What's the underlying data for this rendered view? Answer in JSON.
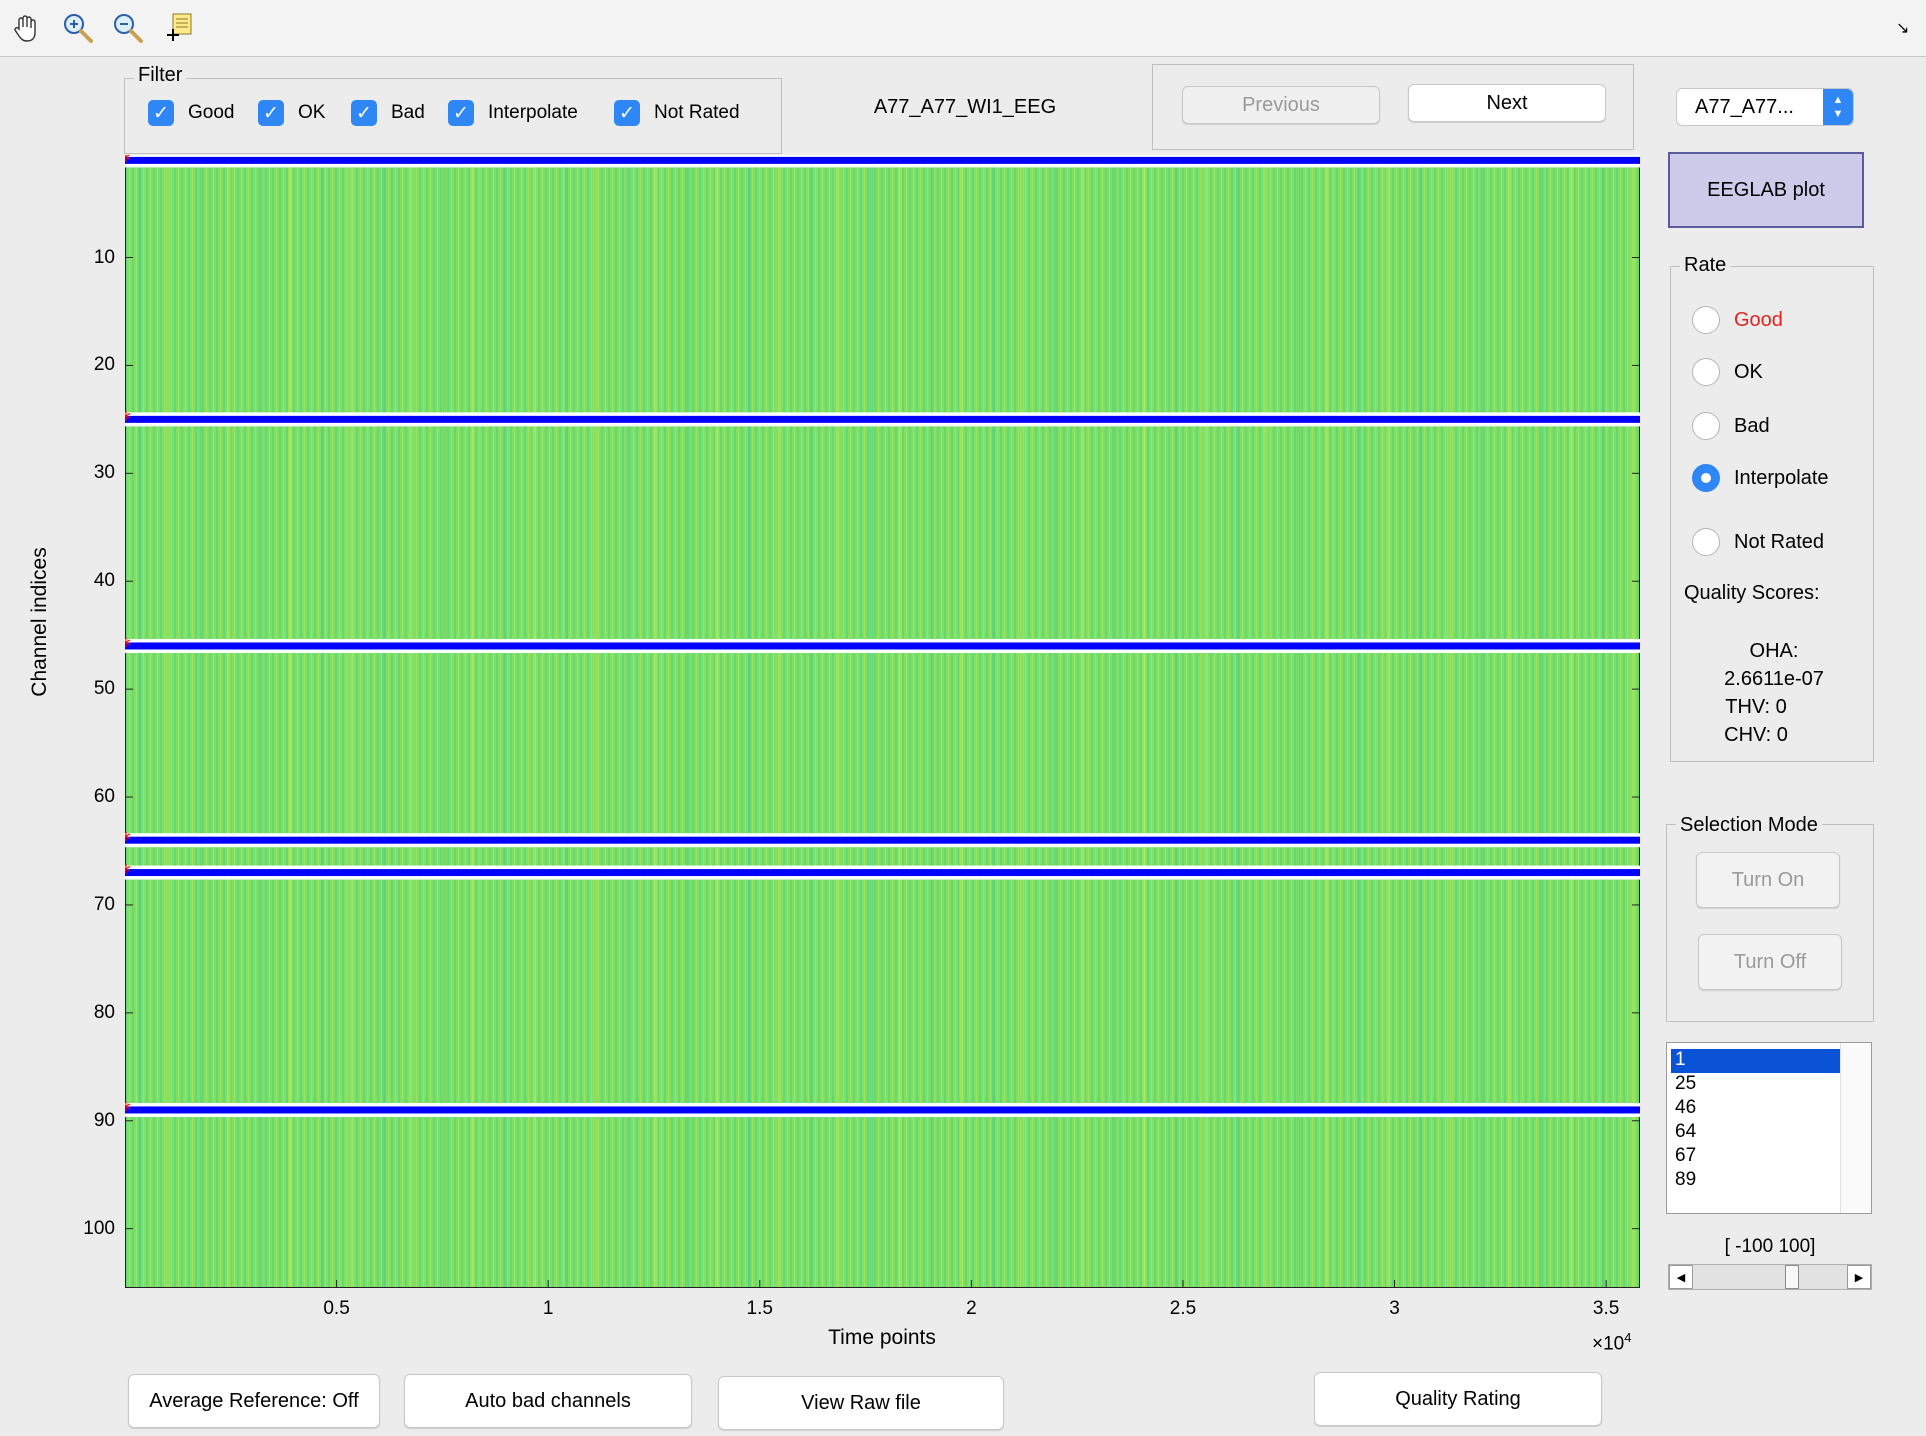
{
  "toolbar": {
    "icons": [
      "hand-pan-icon",
      "zoom-in-icon",
      "zoom-out-icon",
      "data-cursor-icon"
    ],
    "right_icon": "undock-icon"
  },
  "filter": {
    "title": "Filter",
    "items": [
      {
        "label": "Good",
        "checked": true
      },
      {
        "label": "OK",
        "checked": true
      },
      {
        "label": "Bad",
        "checked": true
      },
      {
        "label": "Interpolate",
        "checked": true
      },
      {
        "label": "Not Rated",
        "checked": true
      }
    ]
  },
  "file_name": "A77_A77_WI1_EEG",
  "nav": {
    "previous": "Previous",
    "next": "Next"
  },
  "subject_select": {
    "value": "A77_A77..."
  },
  "eeglab_button": "EEGLAB plot",
  "rate": {
    "title": "Rate",
    "options": [
      {
        "label": "Good",
        "selected": false,
        "color": "#e0241d"
      },
      {
        "label": "OK",
        "selected": false
      },
      {
        "label": "Bad",
        "selected": false
      },
      {
        "label": "Interpolate",
        "selected": true
      },
      {
        "label": "Not Rated",
        "selected": false
      }
    ],
    "quality_title": "Quality Scores:",
    "scores": [
      "OHA:",
      "2.6611e-07",
      "THV: 0",
      "CHV: 0"
    ]
  },
  "selection_mode": {
    "title": "Selection Mode",
    "on": "Turn On",
    "off": "Turn Off"
  },
  "channel_list": {
    "items": [
      "1",
      "25",
      "46",
      "64",
      "67",
      "89"
    ],
    "selected_index": 0
  },
  "scale": {
    "label": "[ -100 100]",
    "slider_value": 0.65
  },
  "bottom_buttons": {
    "avg_ref": "Average Reference: Off",
    "auto_bad": "Auto bad channels",
    "view_raw": "View Raw file",
    "quality": "Quality Rating"
  },
  "chart_data": {
    "type": "heatmap",
    "xlabel": "Time points",
    "ylabel": "Channel indices",
    "x_multiplier": "×10",
    "x_multiplier_exp": "4",
    "xlim": [
      0,
      3.58
    ],
    "ylim": [
      0.5,
      105.5
    ],
    "xticks": [
      0.5,
      1,
      1.5,
      2,
      2.5,
      3,
      3.5
    ],
    "xtick_labels": [
      "0.5",
      "1",
      "1.5",
      "2",
      "2.5",
      "3",
      "3.5"
    ],
    "yticks": [
      10,
      20,
      30,
      40,
      50,
      60,
      70,
      80,
      90,
      100
    ],
    "ytick_labels": [
      "10",
      "20",
      "30",
      "40",
      "50",
      "60",
      "70",
      "80",
      "90",
      "100"
    ],
    "marked_channels": [
      1,
      25,
      46,
      64,
      67,
      89
    ],
    "marker_color": "#0000ff",
    "star_color": "#ff0000"
  }
}
